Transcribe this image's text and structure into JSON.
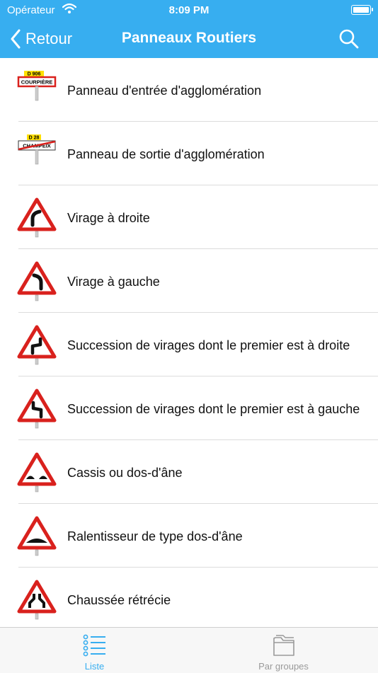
{
  "status": {
    "carrier": "Opérateur",
    "time": "8:09 PM"
  },
  "nav": {
    "back_label": "Retour",
    "title": "Panneaux Routiers"
  },
  "items": [
    {
      "label": "Panneau d'entrée d'agglomération",
      "icon": "entry-sign-icon",
      "sign_route": "D 906",
      "sign_town": "COURPIÈRE"
    },
    {
      "label": "Panneau de sortie d'agglomération",
      "icon": "exit-sign-icon",
      "sign_route": "D 28",
      "sign_town": "CHAMPEIX"
    },
    {
      "label": "Virage à droite",
      "icon": "right-curve-sign-icon"
    },
    {
      "label": "Virage à gauche",
      "icon": "left-curve-sign-icon"
    },
    {
      "label": "Succession de virages dont le premier est à droite",
      "icon": "double-bend-right-sign-icon"
    },
    {
      "label": "Succession de virages dont le premier est à gauche",
      "icon": "double-bend-left-sign-icon"
    },
    {
      "label": "Cassis ou dos-d'âne",
      "icon": "bumpy-road-sign-icon"
    },
    {
      "label": "Ralentisseur de type dos-d'âne",
      "icon": "speed-bump-sign-icon"
    },
    {
      "label": "Chaussée rétrécie",
      "icon": "road-narrows-sign-icon"
    }
  ],
  "tabs": {
    "list": {
      "label": "Liste",
      "active": true
    },
    "groups": {
      "label": "Par groupes",
      "active": false
    }
  },
  "colors": {
    "accent": "#37aef0",
    "sign_red": "#d9211d",
    "inactive": "#9a9a9a"
  }
}
